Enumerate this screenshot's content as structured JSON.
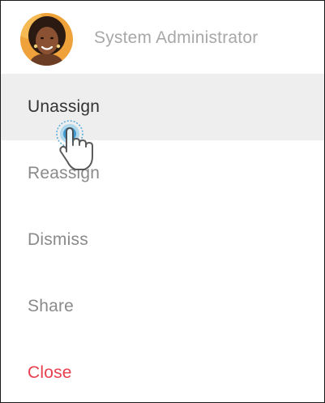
{
  "header": {
    "user_name": "System Administrator",
    "avatar_icon": "user-avatar"
  },
  "menu": {
    "items": [
      {
        "label": "Unassign",
        "state": "hover"
      },
      {
        "label": "Reassign",
        "state": "normal"
      },
      {
        "label": "Dismiss",
        "state": "normal"
      },
      {
        "label": "Share",
        "state": "normal"
      },
      {
        "label": "Close",
        "state": "danger"
      }
    ]
  },
  "colors": {
    "hover_bg": "#eeeeee",
    "text_dark": "#333333",
    "text_muted": "#8a8a8a",
    "header_text": "#a8a8a8",
    "danger": "#e8404f",
    "cursor_ring": "#3aa0d8"
  },
  "cursor_icon": "hand-pointer-click-icon"
}
